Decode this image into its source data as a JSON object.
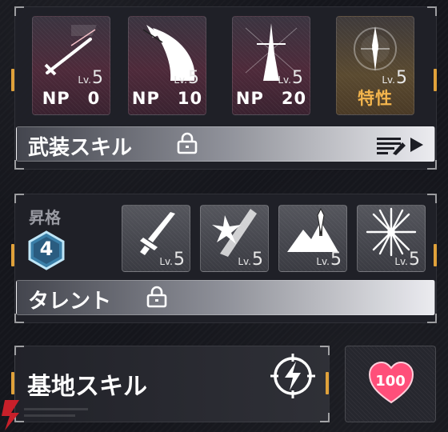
{
  "weapon_skills": {
    "cards": [
      {
        "icon": "sword-icon",
        "level_prefix": "Lv.",
        "level": "5",
        "label": "NP　0"
      },
      {
        "icon": "slash-icon",
        "level_prefix": "Lv.",
        "level": "5",
        "label": "NP　10"
      },
      {
        "icon": "light-pillar-icon",
        "level_prefix": "Lv.",
        "level": "5",
        "label": "NP　20"
      },
      {
        "icon": "compass-star-icon",
        "level_prefix": "Lv.",
        "level": "5",
        "label": "特性"
      }
    ],
    "bar_label": "武装スキル"
  },
  "ascension": {
    "label": "昇格",
    "rank": "4",
    "talents": [
      {
        "icon": "blade-icon",
        "level_prefix": "Lv.",
        "level": "5"
      },
      {
        "icon": "burst-slash-icon",
        "level_prefix": "Lv.",
        "level": "5"
      },
      {
        "icon": "mountain-blade-icon",
        "level_prefix": "Lv.",
        "level": "5"
      },
      {
        "icon": "radiant-star-icon",
        "level_prefix": "Lv.",
        "level": "5"
      }
    ],
    "bar_label": "タレント"
  },
  "base_skill": {
    "label": "基地スキル",
    "icon": "lightning-crosshair-icon",
    "heart_value": "100"
  },
  "colors": {
    "accent": "#e0a13a",
    "trait": "#f4b54d",
    "heart": "#ff4f7a"
  }
}
